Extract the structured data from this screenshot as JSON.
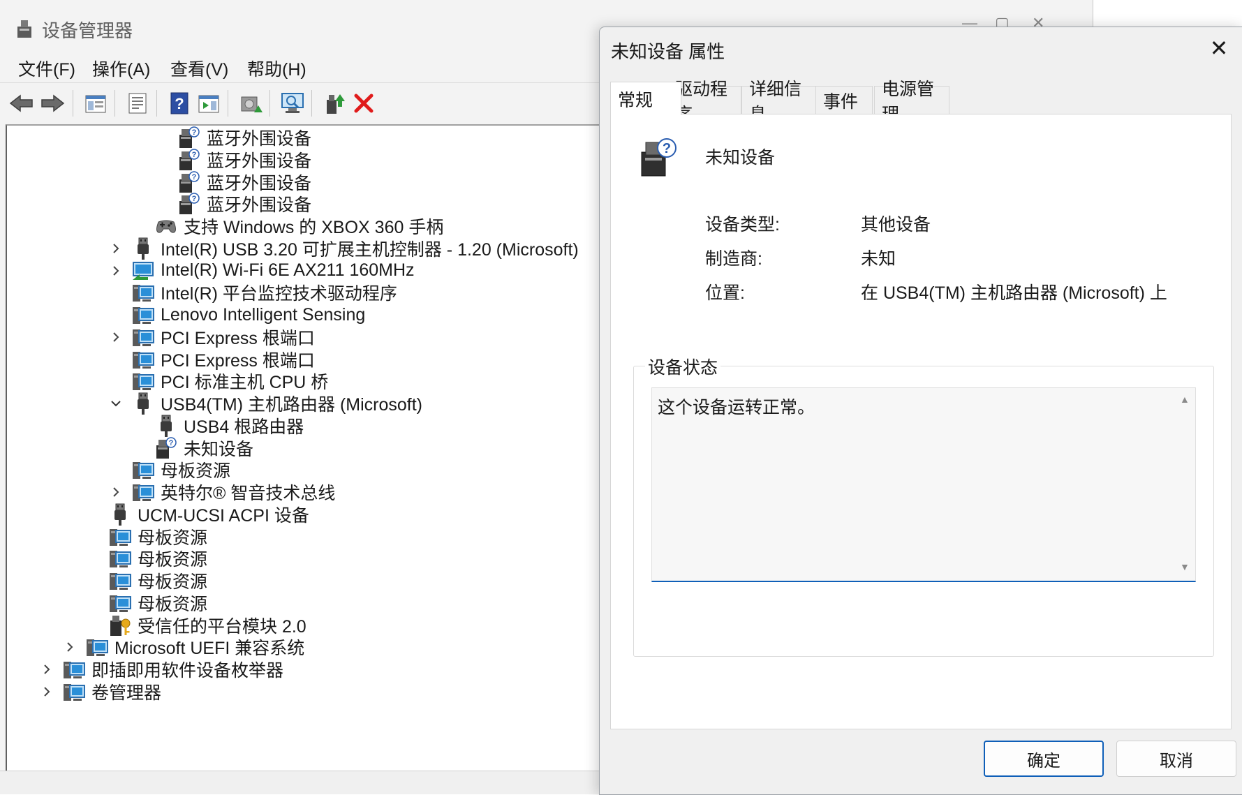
{
  "device_manager": {
    "title": "设备管理器",
    "menu": [
      "文件(F)",
      "操作(A)",
      "查看(V)",
      "帮助(H)"
    ],
    "toolbar_icons": [
      "back-arrow-icon",
      "forward-arrow-icon",
      "show-hide-console-tree-icon",
      "properties-icon",
      "help-icon",
      "action-pane-icon",
      "update-driver-icon",
      "scan-hardware-icon",
      "enable-device-icon",
      "uninstall-device-icon"
    ],
    "tree": [
      {
        "label": "蓝牙外围设备",
        "indent": 4,
        "chevron": "",
        "icon": "unknown-device-icon"
      },
      {
        "label": "蓝牙外围设备",
        "indent": 4,
        "chevron": "",
        "icon": "unknown-device-icon"
      },
      {
        "label": "蓝牙外围设备",
        "indent": 4,
        "chevron": "",
        "icon": "unknown-device-icon"
      },
      {
        "label": "蓝牙外围设备",
        "indent": 4,
        "chevron": "",
        "icon": "unknown-device-icon"
      },
      {
        "label": "支持 Windows 的 XBOX 360 手柄",
        "indent": 3,
        "chevron": "",
        "icon": "gamepad-icon"
      },
      {
        "label": "Intel(R) USB 3.20 可扩展主机控制器 - 1.20 (Microsoft)",
        "indent": 2,
        "chevron": "collapsed",
        "icon": "usb-plug-icon"
      },
      {
        "label": "Intel(R) Wi-Fi 6E AX211 160MHz",
        "indent": 2,
        "chevron": "collapsed",
        "icon": "network-adapter-icon"
      },
      {
        "label": "Intel(R) 平台监控技术驱动程序",
        "indent": 2,
        "chevron": "",
        "icon": "system-device-icon"
      },
      {
        "label": "Lenovo Intelligent Sensing",
        "indent": 2,
        "chevron": "",
        "icon": "system-device-icon"
      },
      {
        "label": "PCI Express 根端口",
        "indent": 2,
        "chevron": "collapsed",
        "icon": "system-device-icon"
      },
      {
        "label": "PCI Express 根端口",
        "indent": 2,
        "chevron": "",
        "icon": "system-device-icon"
      },
      {
        "label": "PCI 标准主机 CPU 桥",
        "indent": 2,
        "chevron": "",
        "icon": "system-device-icon"
      },
      {
        "label": "USB4(TM) 主机路由器 (Microsoft)",
        "indent": 2,
        "chevron": "expanded",
        "icon": "usb-plug-icon"
      },
      {
        "label": "USB4 根路由器",
        "indent": 3,
        "chevron": "",
        "icon": "usb-plug-icon"
      },
      {
        "label": "未知设备",
        "indent": 3,
        "chevron": "",
        "icon": "unknown-device-icon"
      },
      {
        "label": "母板资源",
        "indent": 2,
        "chevron": "",
        "icon": "system-device-icon"
      },
      {
        "label": "英特尔® 智音技术总线",
        "indent": 2,
        "chevron": "collapsed",
        "icon": "system-device-icon"
      },
      {
        "label": "UCM-UCSI ACPI 设备",
        "indent": 1,
        "chevron": "",
        "icon": "usb-plug-icon"
      },
      {
        "label": "母板资源",
        "indent": 1,
        "chevron": "",
        "icon": "system-device-icon"
      },
      {
        "label": "母板资源",
        "indent": 1,
        "chevron": "",
        "icon": "system-device-icon"
      },
      {
        "label": "母板资源",
        "indent": 1,
        "chevron": "",
        "icon": "system-device-icon"
      },
      {
        "label": "母板资源",
        "indent": 1,
        "chevron": "",
        "icon": "system-device-icon"
      },
      {
        "label": "受信任的平台模块 2.0",
        "indent": 1,
        "chevron": "",
        "icon": "tpm-key-icon"
      },
      {
        "label": "Microsoft UEFI 兼容系统",
        "indent": 0,
        "chevron": "collapsed",
        "icon": "system-device-icon"
      },
      {
        "label": "即插即用软件设备枚举器",
        "indent": -1,
        "chevron": "collapsed",
        "icon": "system-device-icon"
      },
      {
        "label": "卷管理器",
        "indent": -1,
        "chevron": "collapsed",
        "icon": "system-device-icon"
      }
    ]
  },
  "properties_dialog": {
    "title": "未知设备 属性",
    "close_glyph": "✕",
    "tabs": [
      "常规",
      "驱动程序",
      "详细信息",
      "事件",
      "电源管理"
    ],
    "active_tab": "常规",
    "device_name": "未知设备",
    "fields": [
      {
        "label": "设备类型:",
        "value": "其他设备"
      },
      {
        "label": "制造商:",
        "value": "未知"
      },
      {
        "label": "位置:",
        "value": "在 USB4(TM) 主机路由器 (Microsoft) 上"
      }
    ],
    "status_group_label": "设备状态",
    "status_text": "这个设备运转正常。",
    "ok_label": "确定",
    "cancel_label": "取消"
  },
  "colors": {
    "accent": "#0f5fb8",
    "uninstall_red": "#e01b1b",
    "monitor_blue": "#2a8fd8"
  }
}
